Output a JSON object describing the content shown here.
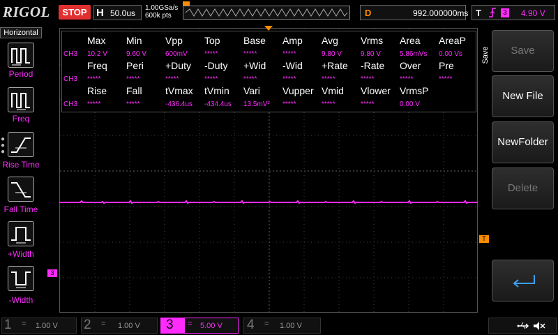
{
  "header": {
    "logo": "RIGOL",
    "run_state": "STOP",
    "timebase_label": "H",
    "timebase_value": "50.0us",
    "sample_rate": "1.00GSa/s",
    "memory_depth": "600k pts",
    "delay_label": "D",
    "delay_value": "992.000000ms",
    "trigger_label": "T",
    "trigger_source": "3",
    "trigger_level": "4.90 V"
  },
  "left_menu": {
    "title": "Horizontal",
    "items": [
      {
        "label": "Period",
        "icon": "period-icon"
      },
      {
        "label": "Freq",
        "icon": "frequency-icon"
      },
      {
        "label": "Rise Time",
        "icon": "rise-time-icon"
      },
      {
        "label": "Fall Time",
        "icon": "fall-time-icon"
      },
      {
        "label": "+Width",
        "icon": "positive-width-icon"
      },
      {
        "label": "-Width",
        "icon": "negative-width-icon"
      }
    ]
  },
  "measurements": {
    "channel": "CH3",
    "rows": [
      {
        "headers": [
          "Max",
          "Min",
          "Vpp",
          "Top",
          "Base",
          "Amp",
          "Avg",
          "Vrms",
          "Area",
          "AreaP"
        ],
        "values": [
          "10.2 V",
          "9.60 V",
          "600mV",
          "*****",
          "*****",
          "*****",
          "9.80 V",
          "9.80 V",
          "5.86mVs",
          "0.00 Vs"
        ]
      },
      {
        "headers": [
          "Freq",
          "Peri",
          "+Duty",
          "-Duty",
          "+Wid",
          "-Wid",
          "+Rate",
          "-Rate",
          "Over",
          "Pre"
        ],
        "values": [
          "*****",
          "*****",
          "*****",
          "*****",
          "*****",
          "*****",
          "*****",
          "*****",
          "*****",
          "*****"
        ]
      },
      {
        "headers": [
          "Rise",
          "Fall",
          "tVmax",
          "tVmin",
          "Vari",
          "Vupper",
          "Vmid",
          "Vlower",
          "VrmsP",
          ""
        ],
        "values": [
          "*****",
          "*****",
          "-436.4us",
          "-434.4us",
          "13.5mV²",
          "*****",
          "*****",
          "*****",
          "0.00 V",
          ""
        ]
      }
    ]
  },
  "markers": {
    "ch3_marker": "3",
    "trigger_marker": "T"
  },
  "right_menu": {
    "title": "Save",
    "items": [
      {
        "label": "Save",
        "enabled": false
      },
      {
        "label": "New File",
        "enabled": true
      },
      {
        "label": "NewFolder",
        "enabled": true
      },
      {
        "label": "Delete",
        "enabled": false
      },
      {
        "label": "",
        "icon": "return-arrow-icon",
        "enabled": true
      }
    ]
  },
  "channels": [
    {
      "num": "1",
      "coupling": "=",
      "scale": "1.00 V",
      "active": false,
      "color": "#d8d800"
    },
    {
      "num": "2",
      "coupling": "=",
      "scale": "1.00 V",
      "active": false,
      "color": "#00e0ff"
    },
    {
      "num": "3",
      "coupling": "=",
      "scale": "5.00 V",
      "active": true,
      "color": "#ff2bff"
    },
    {
      "num": "4",
      "coupling": "=",
      "scale": "1.00 V",
      "active": false,
      "color": "#3a8aff"
    }
  ],
  "status": {
    "usb_icon": "usb-icon",
    "speaker_icon": "speaker-muted-icon"
  },
  "colors": {
    "ch3": "#ff2bff",
    "trigger": "#ff8c00",
    "stop": "#e03030"
  }
}
